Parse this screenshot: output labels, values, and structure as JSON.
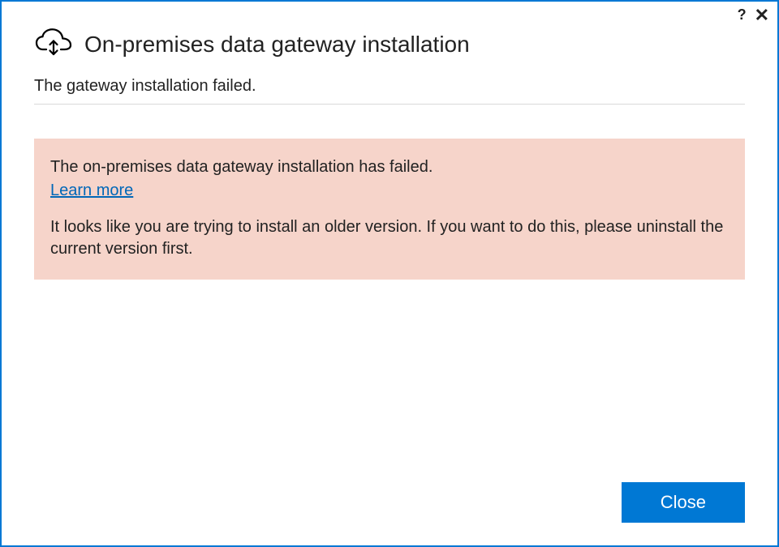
{
  "titlebar": {
    "help": "?",
    "close": "✕"
  },
  "header": {
    "title": "On-premises data gateway installation"
  },
  "status": {
    "message": "The gateway installation failed."
  },
  "error": {
    "summary": "The on-premises data gateway installation has failed.",
    "learn_more_label": "Learn more",
    "detail": "It looks like you are trying to install an older version. If you want to do this, please uninstall the current version first."
  },
  "footer": {
    "close_label": "Close"
  },
  "colors": {
    "accent": "#0078d4",
    "error_bg": "#f6d4ca",
    "link": "#0067b8"
  }
}
